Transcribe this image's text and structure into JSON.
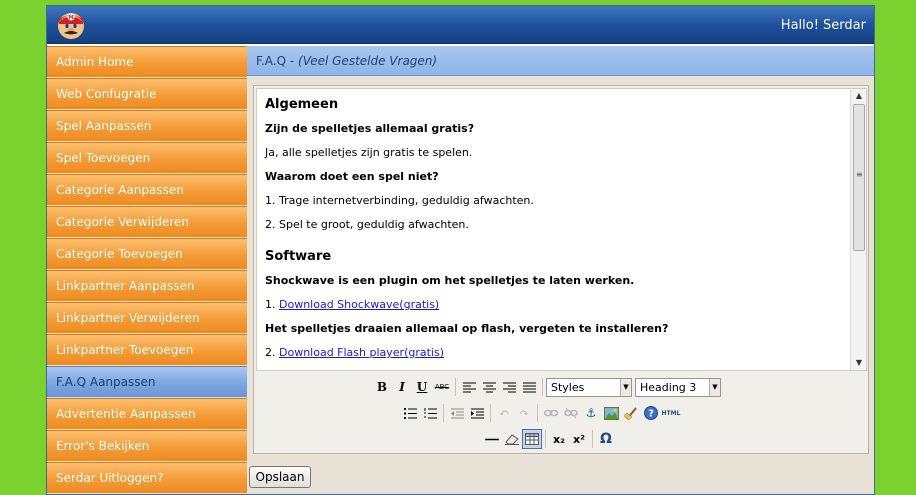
{
  "header": {
    "greeting": "Hallo! Serdar"
  },
  "sidebar": {
    "items": [
      {
        "label": "Admin Home"
      },
      {
        "label": "Web Confugratie"
      },
      {
        "label": "Spel Aanpassen"
      },
      {
        "label": "Spel Toevoegen"
      },
      {
        "label": "Categorie Aanpassen"
      },
      {
        "label": "Categorie Verwijderen"
      },
      {
        "label": "Categorie Toevoegen"
      },
      {
        "label": "Linkpartner Aanpassen"
      },
      {
        "label": "Linkpartner Verwijderen"
      },
      {
        "label": "Linkpartner Toevoegen"
      },
      {
        "label": "F.A.Q Aanpassen",
        "active": true
      },
      {
        "label": "Advertentie Aanpassen"
      },
      {
        "label": "Error's Bekijken"
      },
      {
        "label": "Serdar Uitloggen?"
      }
    ]
  },
  "page": {
    "title": "F.A.Q",
    "subtitle": "(Veel Gestelde Vragen)"
  },
  "editor": {
    "heading1": "Algemeen",
    "q1": "Zijn de spelletjes allemaal gratis?",
    "a1": "Ja, alle spelletjes zijn gratis te spelen.",
    "q2": "Waarom doet een spel niet?",
    "a2_1": "1. Trage internetverbinding, geduldig afwachten.",
    "a2_2": "2. Spel te groot, geduldig afwachten.",
    "heading2": "Software",
    "q3": "Shockwave is een plugin om het spelletjes te laten werken.",
    "a3_prefix": "1. ",
    "a3_link": "Download Shockwave(gratis)",
    "q4": "Het spelletjes draaien allemaal op flash, vergeten te installeren?",
    "a4_prefix": "2. ",
    "a4_link": "Download Flash player(gratis)",
    "styles_select": "Styles",
    "format_select": "Heading 3"
  },
  "toolbar": {
    "bold": "B",
    "italic": "I",
    "underline": "U",
    "strike": "ABC",
    "html": "HTML",
    "sub": "x₂",
    "sup": "x²",
    "omega": "Ω"
  },
  "actions": {
    "save_label": "Opslaan"
  }
}
